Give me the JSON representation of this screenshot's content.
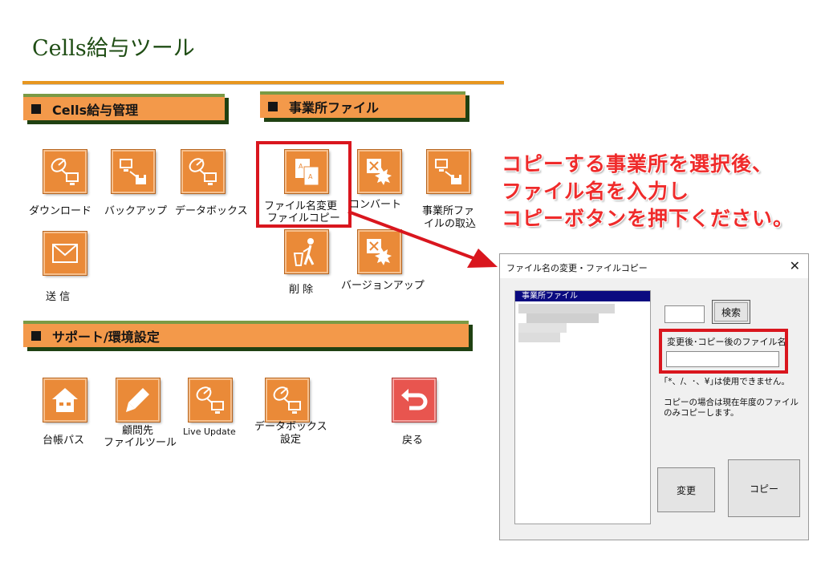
{
  "app": {
    "title": "Cells給与ツール"
  },
  "sections": {
    "cells": "Cells給与管理",
    "office": "事業所ファイル",
    "support": "サポート/環境設定"
  },
  "buttons": {
    "download": "ダウンロード",
    "backup": "バックアップ",
    "databox": "データボックス",
    "send": "送 信",
    "rename_copy_1": "ファイル名変更",
    "rename_copy_2": "ファイルコピー",
    "convert": "コンバート",
    "import_1": "事業所ファ",
    "import_2": "イルの取込",
    "delete": "削 除",
    "version_up": "バージョンアップ",
    "ledger_path": "台帳パス",
    "advisor_1": "顧問先",
    "advisor_2": "ファイルツール",
    "live_update": "Live Update",
    "databox_setting_1": "データボックス",
    "databox_setting_2": "設定",
    "back": "戻る"
  },
  "instruction": {
    "line1": "コピーする事業所を選択後、",
    "line2": "ファイル名を入力し",
    "line3": "コピーボタンを押下ください。"
  },
  "dialog": {
    "title": "ファイル名の変更・ファイルコピー",
    "close": "✕",
    "list_header": "事業所ファイル",
    "search_button": "検索",
    "filename_label": "変更後･コピー後のファイル名",
    "search_value": "",
    "filename_value": "",
    "note1": "｢*、/、･、¥｣は使用できません。",
    "note2_1": "コピーの場合は現在年度のファイル",
    "note2_2": "のみコピーします。",
    "change_button": "変更",
    "copy_button": "コピー"
  },
  "colors": {
    "accent_orange": "#ea8a38",
    "section_bg": "#f3994a",
    "title_green": "#1f4d14",
    "highlight_red": "#d9161e",
    "list_header": "#0a0a80"
  },
  "icons": [
    "satellite-computer-icon",
    "computer-disk-icon",
    "envelope-icon",
    "document-a-icon",
    "convert-icon",
    "trash-person-icon",
    "house-icon",
    "pen-icon",
    "undo-arrow-icon"
  ]
}
